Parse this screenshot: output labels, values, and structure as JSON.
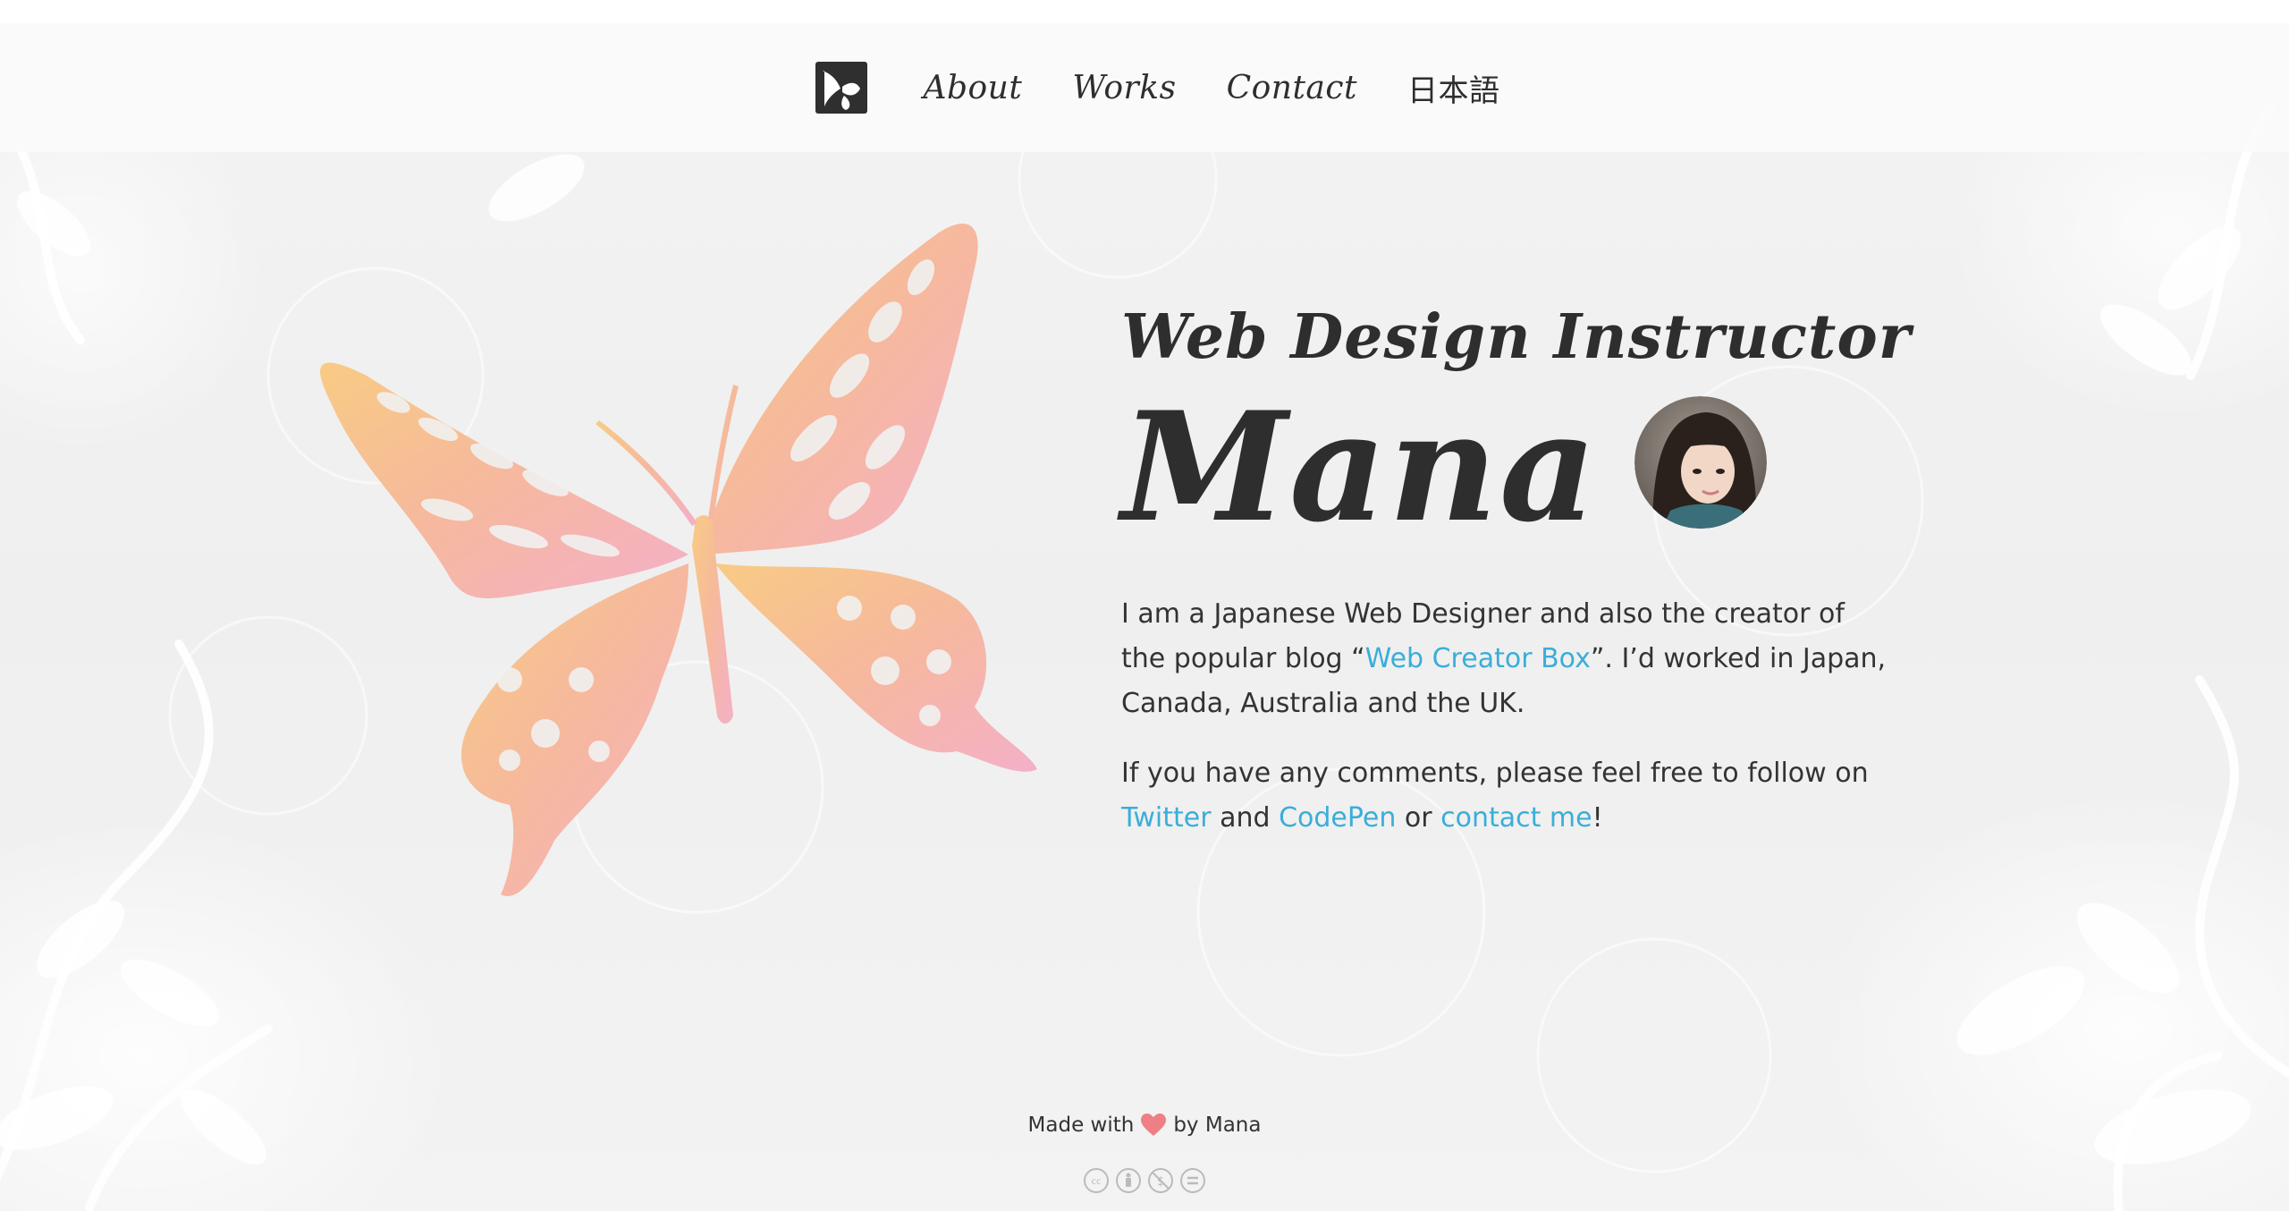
{
  "nav": {
    "logo_alt": "",
    "items": [
      {
        "label": "About"
      },
      {
        "label": "Works"
      },
      {
        "label": "Contact"
      },
      {
        "label": "日本語"
      }
    ]
  },
  "hero": {
    "subtitle": "Web Design Instructor",
    "name": "Mana",
    "bio1_part1": "I am a Japanese Web Designer and also the creator of the popular blog “",
    "bio1_link": "Web Creator Box",
    "bio1_part2": "”. I’d worked in Japan, Canada, Australia and the UK.",
    "bio2_part1": "If you have any comments, please feel free to follow on ",
    "twitter_link": "Twitter",
    "and_text": " and ",
    "codepen_link": "CodePen",
    "or_text": " or ",
    "contact_link": "contact me",
    "bang_text": "!"
  },
  "footer": {
    "made_with": "Made with",
    "by": "by Mana"
  },
  "colors": {
    "link": "#3aaed8",
    "butterfly_top": "#f7c685",
    "butterfly_bottom": "#f5b5c4",
    "heart": "#ee7f85"
  },
  "icons": {
    "logo": "mana-logo-icon",
    "heart": "heart-icon",
    "license": [
      "cc-icon",
      "by-icon",
      "nc-icon",
      "nd-icon"
    ]
  }
}
